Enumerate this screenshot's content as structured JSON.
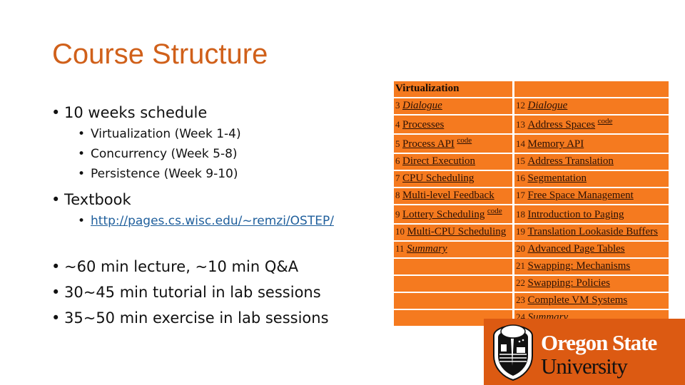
{
  "slide": {
    "title": "Course Structure",
    "bullets": [
      {
        "text": "10 weeks schedule",
        "sub": [
          "Virtualization (Week 1-4)",
          "Concurrency (Week 5-8)",
          "Persistence (Week 9-10)"
        ]
      },
      {
        "text": "Textbook",
        "sub_link": "http://pages.cs.wisc.edu/~remzi/OSTEP/"
      },
      {
        "text": "~60 min lecture, ~10 min Q&A"
      },
      {
        "text": "30~45 min tutorial in lab sessions"
      },
      {
        "text": "35~50 min exercise in lab sessions"
      }
    ],
    "bullet_glyph": "•"
  },
  "toc": {
    "header": "Virtualization",
    "colors": {
      "cell": "#f57a1f",
      "border": "#ffffff"
    },
    "left": [
      {
        "num": "3",
        "title": "Dialogue",
        "italic": true,
        "code": ""
      },
      {
        "num": "4",
        "title": "Processes",
        "italic": false,
        "code": ""
      },
      {
        "num": "5",
        "title": "Process API",
        "italic": false,
        "code": "code"
      },
      {
        "num": "6",
        "title": "Direct Execution",
        "italic": false,
        "code": ""
      },
      {
        "num": "7",
        "title": "CPU Scheduling",
        "italic": false,
        "code": ""
      },
      {
        "num": "8",
        "title": "Multi-level Feedback",
        "italic": false,
        "code": ""
      },
      {
        "num": "9",
        "title": "Lottery Scheduling",
        "italic": false,
        "code": "code"
      },
      {
        "num": "10",
        "title": "Multi-CPU Scheduling",
        "italic": false,
        "code": ""
      },
      {
        "num": "11",
        "title": "Summary",
        "italic": true,
        "code": ""
      },
      {
        "num": "",
        "title": "",
        "italic": false,
        "code": ""
      },
      {
        "num": "",
        "title": "",
        "italic": false,
        "code": ""
      },
      {
        "num": "",
        "title": "",
        "italic": false,
        "code": ""
      },
      {
        "num": "",
        "title": "",
        "italic": false,
        "code": ""
      }
    ],
    "right": [
      {
        "num": "12",
        "title": "Dialogue",
        "italic": true,
        "code": ""
      },
      {
        "num": "13",
        "title": "Address Spaces",
        "italic": false,
        "code": "code"
      },
      {
        "num": "14",
        "title": "Memory API",
        "italic": false,
        "code": ""
      },
      {
        "num": "15",
        "title": "Address Translation",
        "italic": false,
        "code": ""
      },
      {
        "num": "16",
        "title": "Segmentation",
        "italic": false,
        "code": ""
      },
      {
        "num": "17",
        "title": "Free Space Management",
        "italic": false,
        "code": ""
      },
      {
        "num": "18",
        "title": "Introduction to Paging",
        "italic": false,
        "code": ""
      },
      {
        "num": "19",
        "title": "Translation Lookaside Buffers",
        "italic": false,
        "code": ""
      },
      {
        "num": "20",
        "title": "Advanced Page Tables",
        "italic": false,
        "code": ""
      },
      {
        "num": "21",
        "title": "Swapping: Mechanisms",
        "italic": false,
        "code": ""
      },
      {
        "num": "22",
        "title": "Swapping: Policies",
        "italic": false,
        "code": ""
      },
      {
        "num": "23",
        "title": "Complete VM Systems",
        "italic": false,
        "code": ""
      },
      {
        "num": "24",
        "title": "Summary",
        "italic": true,
        "code": ""
      }
    ]
  },
  "logo": {
    "line1": "Oregon State",
    "line2": "University",
    "icon": "beaver-shield-icon",
    "background": "#dc5a12"
  }
}
